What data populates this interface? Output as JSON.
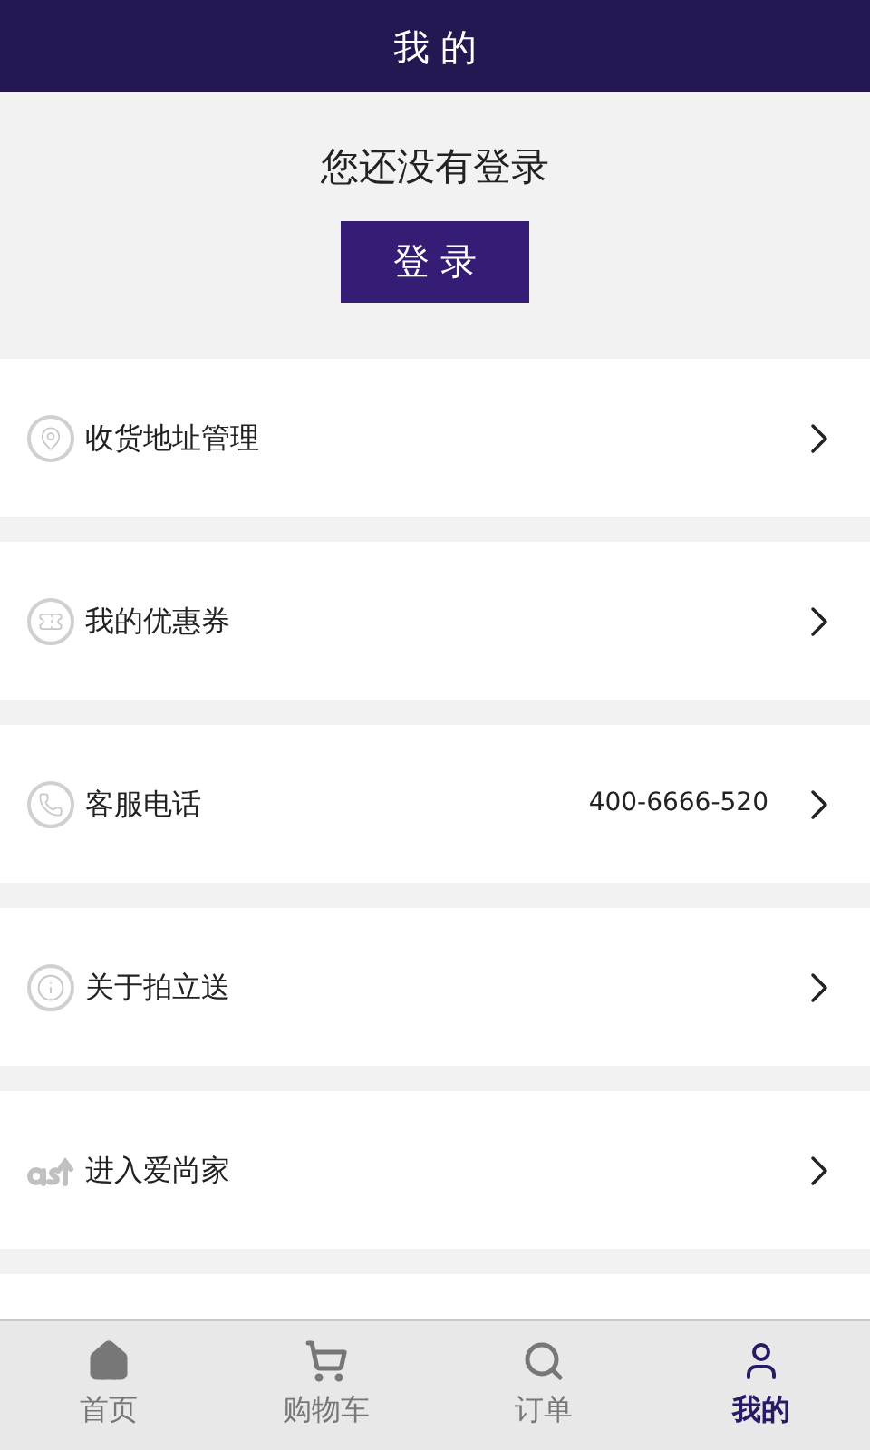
{
  "header": {
    "title": "我 的"
  },
  "login": {
    "message": "您还没有登录",
    "button": "登 录"
  },
  "menu": [
    {
      "label": "收货地址管理"
    },
    {
      "label": "我的优惠券"
    },
    {
      "label": "客服电话",
      "value": "400-6666-520"
    },
    {
      "label": "关于拍立送"
    },
    {
      "label": "进入爱尚家"
    }
  ],
  "tabs": [
    {
      "label": "首页",
      "selected": false
    },
    {
      "label": "购物车",
      "selected": false
    },
    {
      "label": "订单",
      "selected": false
    },
    {
      "label": "我的",
      "selected": true
    }
  ]
}
